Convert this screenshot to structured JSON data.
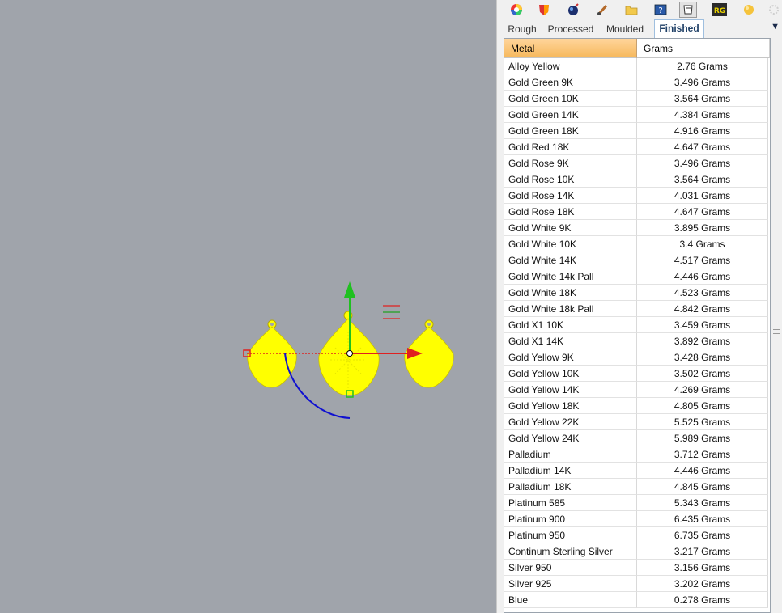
{
  "toolbar": {
    "icons": [
      "color-wheel-icon",
      "shield-icon",
      "globe-icon",
      "brush-icon",
      "folder-icon",
      "help-icon",
      "gem-weight-icon",
      "rg-icon",
      "sphere-icon",
      "settings-icon"
    ]
  },
  "tabs": {
    "items": [
      {
        "label": "Rough"
      },
      {
        "label": "Processed"
      },
      {
        "label": "Moulded"
      },
      {
        "label": "Finished"
      }
    ],
    "active": "Finished"
  },
  "table": {
    "columns": [
      "Metal",
      "Grams"
    ],
    "rows": [
      [
        "Alloy Yellow",
        "2.76 Grams"
      ],
      [
        "Gold Green 9K",
        "3.496 Grams"
      ],
      [
        "Gold Green 10K",
        "3.564 Grams"
      ],
      [
        "Gold Green 14K",
        "4.384 Grams"
      ],
      [
        "Gold Green 18K",
        "4.916 Grams"
      ],
      [
        "Gold Red 18K",
        "4.647 Grams"
      ],
      [
        "Gold Rose 9K",
        "3.496 Grams"
      ],
      [
        "Gold Rose 10K",
        "3.564 Grams"
      ],
      [
        "Gold Rose 14K",
        "4.031 Grams"
      ],
      [
        "Gold Rose 18K",
        "4.647 Grams"
      ],
      [
        "Gold White 9K",
        "3.895 Grams"
      ],
      [
        "Gold White 10K",
        "3.4 Grams"
      ],
      [
        "Gold White 14K",
        "4.517 Grams"
      ],
      [
        "Gold White 14k Pall",
        "4.446 Grams"
      ],
      [
        "Gold White 18K",
        "4.523 Grams"
      ],
      [
        "Gold White 18k Pall",
        "4.842 Grams"
      ],
      [
        "Gold X1 10K",
        "3.459 Grams"
      ],
      [
        "Gold X1 14K",
        "3.892 Grams"
      ],
      [
        "Gold Yellow 9K",
        "3.428 Grams"
      ],
      [
        "Gold Yellow 10K",
        "3.502 Grams"
      ],
      [
        "Gold Yellow 14K",
        "4.269 Grams"
      ],
      [
        "Gold Yellow 18K",
        "4.805 Grams"
      ],
      [
        "Gold Yellow 22K",
        "5.525 Grams"
      ],
      [
        "Gold Yellow 24K",
        "5.989 Grams"
      ],
      [
        "Palladium",
        "3.712 Grams"
      ],
      [
        "Palladium 14K",
        "4.446 Grams"
      ],
      [
        "Palladium 18K",
        "4.845 Grams"
      ],
      [
        "Platinum 585",
        "5.343 Grams"
      ],
      [
        "Platinum 900",
        "6.435 Grams"
      ],
      [
        "Platinum 950",
        "6.735 Grams"
      ],
      [
        "Continum Sterling Silver",
        "3.217 Grams"
      ],
      [
        "Silver 950",
        "3.156 Grams"
      ],
      [
        "Silver 925",
        "3.202 Grams"
      ],
      [
        "Blue",
        "0.278 Grams"
      ]
    ]
  },
  "colors": {
    "viewport_bg": "#a0a4ab",
    "object_fill": "#ffff00",
    "gumball_x": "#e02020",
    "gumball_y": "#20c020",
    "gumball_rotate": "#1010d0",
    "header_accent": "#f6b85c"
  }
}
